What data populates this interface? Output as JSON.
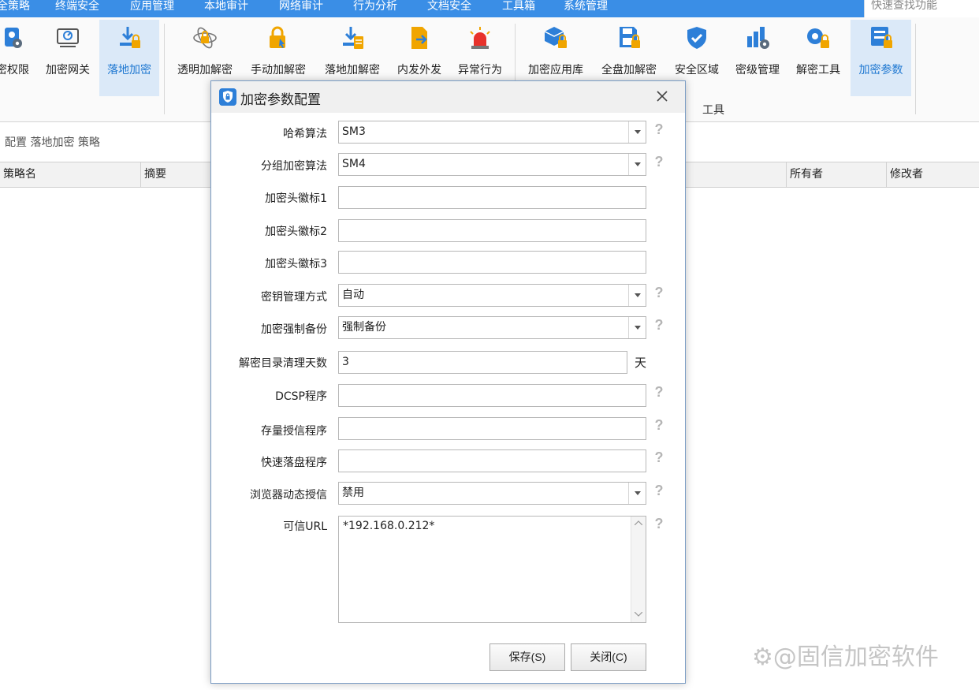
{
  "menubar": {
    "items": [
      "全策略",
      "终端安全",
      "应用管理",
      "本地审计",
      "网络审计",
      "行为分析",
      "文档安全",
      "工具箱",
      "系统管理"
    ],
    "quick_search_placeholder": "快速查找功能"
  },
  "ribbon": {
    "buttons": [
      {
        "label": "密权限",
        "icon": "permission-icon"
      },
      {
        "label": "加密网关",
        "icon": "gateway-icon"
      },
      {
        "label": "落地加密",
        "icon": "landing-encrypt-icon"
      },
      {
        "label": "透明加解密",
        "icon": "transparent-crypto-icon"
      },
      {
        "label": "手动加解密",
        "icon": "manual-crypto-icon"
      },
      {
        "label": "落地加解密",
        "icon": "landing-crypto-icon"
      },
      {
        "label": "内发外发",
        "icon": "send-out-icon"
      },
      {
        "label": "异常行为",
        "icon": "alarm-icon"
      },
      {
        "label": "加密应用库",
        "icon": "app-library-icon"
      },
      {
        "label": "全盘加解密",
        "icon": "disk-crypto-icon"
      },
      {
        "label": "安全区域",
        "icon": "shield-icon"
      },
      {
        "label": "密级管理",
        "icon": "level-chart-icon"
      },
      {
        "label": "解密工具",
        "icon": "decrypt-tool-icon"
      },
      {
        "label": "加密参数",
        "icon": "crypto-params-icon"
      }
    ],
    "active": [
      "落地加密",
      "加密参数"
    ],
    "group_label": "工具"
  },
  "breadcrumb": "配置 落地加密 策略",
  "table": {
    "columns": [
      "策略名",
      "摘要",
      "所有者",
      "修改者"
    ]
  },
  "dialog": {
    "title": "加密参数配置",
    "fields": [
      {
        "label": "哈希算法",
        "type": "select",
        "value": "SM3",
        "help": "?"
      },
      {
        "label": "分组加密算法",
        "type": "select",
        "value": "SM4",
        "help": "?"
      },
      {
        "label": "加密头徽标1",
        "type": "text",
        "value": ""
      },
      {
        "label": "加密头徽标2",
        "type": "text",
        "value": ""
      },
      {
        "label": "加密头徽标3",
        "type": "text",
        "value": ""
      },
      {
        "label": "密钥管理方式",
        "type": "select",
        "value": "自动",
        "help": "?"
      },
      {
        "label": "加密强制备份",
        "type": "select",
        "value": "强制备份",
        "help": "?"
      },
      {
        "label": "解密目录清理天数",
        "type": "text",
        "value": "3",
        "unit": "天"
      },
      {
        "label": "DCSP程序",
        "type": "text",
        "value": "",
        "help": "?"
      },
      {
        "label": "存量授信程序",
        "type": "text",
        "value": "",
        "help": "?"
      },
      {
        "label": "快速落盘程序",
        "type": "text",
        "value": "",
        "help": "?"
      },
      {
        "label": "浏览器动态授信",
        "type": "select",
        "value": "禁用",
        "help": "?"
      },
      {
        "label": "可信URL",
        "type": "textarea",
        "value": "*192.168.0.212*",
        "help": "?"
      }
    ],
    "save_label": "保存(S)",
    "close_label": "关闭(C)"
  },
  "watermark": "⚙@固信加密软件",
  "colors": {
    "menubar": "#3a8ee6",
    "accent": "#1f78d1",
    "active_bg": "#dbe9f8"
  }
}
